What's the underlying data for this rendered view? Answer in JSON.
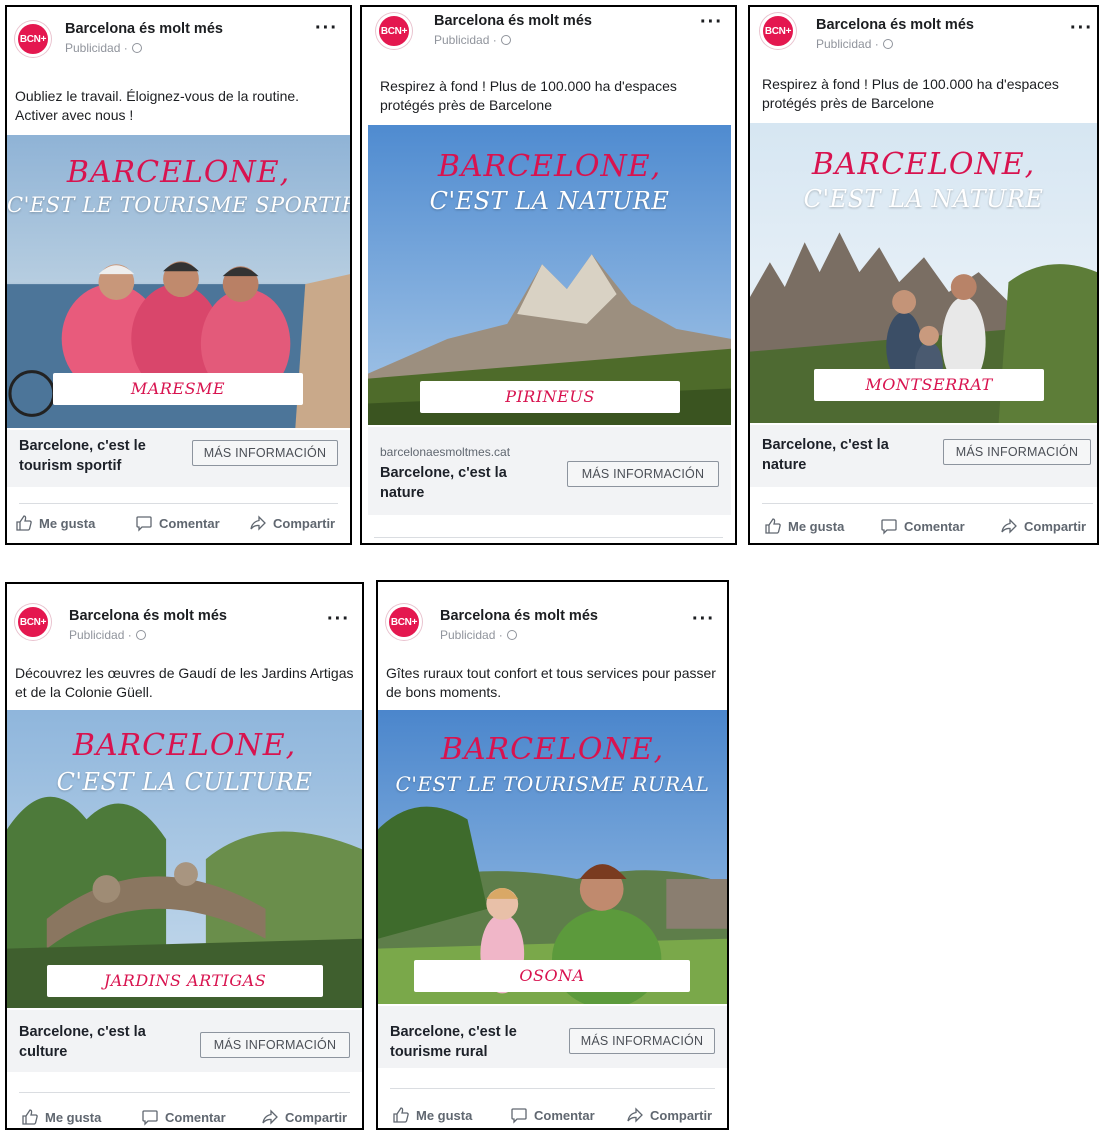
{
  "brand": {
    "avatar_text": "BCN+",
    "page_name": "Barcelona és molt més",
    "sponsored": "Publicidad ·",
    "accent": "#d8134f"
  },
  "actions": {
    "like": "Me gusta",
    "comment": "Comentar",
    "share": "Compartir"
  },
  "cta_label": "MÁS INFORMACIÓN",
  "ads": [
    {
      "body": "Oubliez le travail. Éloignez-vous de la routine. Activer avec nous !",
      "headline_top": "BARCELONE,",
      "headline_bottom": "C'EST LE TOURISME SPORTIF",
      "place": "MARESME",
      "domain": "",
      "link_title": "Barcelone, c'est le tourism sportif"
    },
    {
      "body": "Respirez à fond ! Plus de 100.000 ha d'espaces protégés près de Barcelone",
      "headline_top": "BARCELONE,",
      "headline_bottom": "C'EST LA NATURE",
      "place": "PIRINEUS",
      "domain": "barcelonaesmoltmes.cat",
      "link_title": "Barcelone, c'est la nature"
    },
    {
      "body": "Respirez à fond ! Plus de 100.000 ha d'espaces protégés près de Barcelone",
      "headline_top": "BARCELONE,",
      "headline_bottom": "C'EST LA NATURE",
      "place": "MONTSERRAT",
      "domain": "",
      "link_title": "Barcelone, c'est la nature"
    },
    {
      "body": "Découvrez les œuvres de Gaudí de les Jardins Artigas et de la Colonie Güell.",
      "headline_top": "BARCELONE,",
      "headline_bottom": "C'EST LA CULTURE",
      "place": "JARDINS ARTIGAS",
      "domain": "",
      "link_title": "Barcelone, c'est la culture"
    },
    {
      "body": "Gîtes ruraux tout confort et tous services pour passer de bons moments.",
      "headline_top": "BARCELONE,",
      "headline_bottom": "C'EST LE TOURISME RURAL",
      "place": "OSONA",
      "domain": "",
      "link_title": "Barcelone, c'est le tourisme rural"
    }
  ]
}
